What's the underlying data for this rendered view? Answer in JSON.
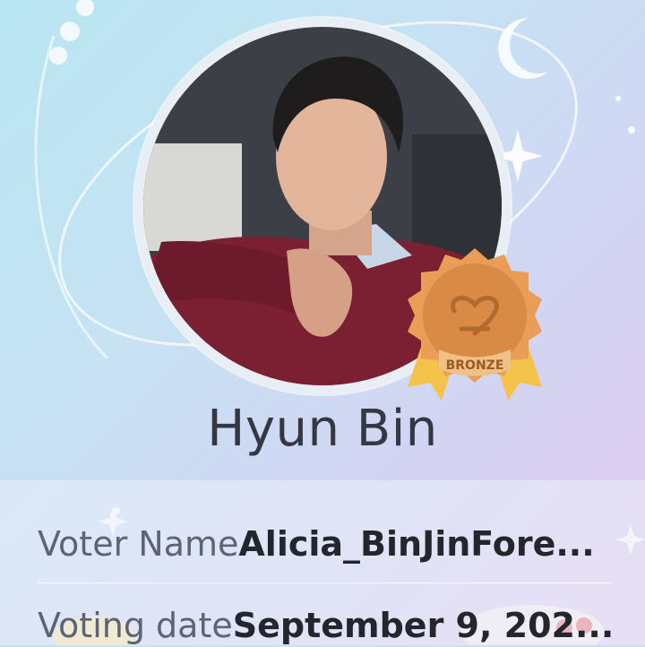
{
  "celebrity": {
    "name": "Hyun Bin"
  },
  "badge": {
    "label": "BRONZE",
    "color": "#d98b45",
    "ribbon_color": "#f3c34a"
  },
  "details": {
    "voter_label": "Voter Name",
    "voter_value": "Alicia_BinJinFore...",
    "date_label": "Voting date",
    "date_value": "September 9, 202..."
  },
  "icons": [
    "moon-icon",
    "sparkle-icon",
    "heart-icon"
  ],
  "colors": {
    "background_start": "#b9e6f2",
    "background_end": "#e3c9ef",
    "name_text": "#333842"
  }
}
